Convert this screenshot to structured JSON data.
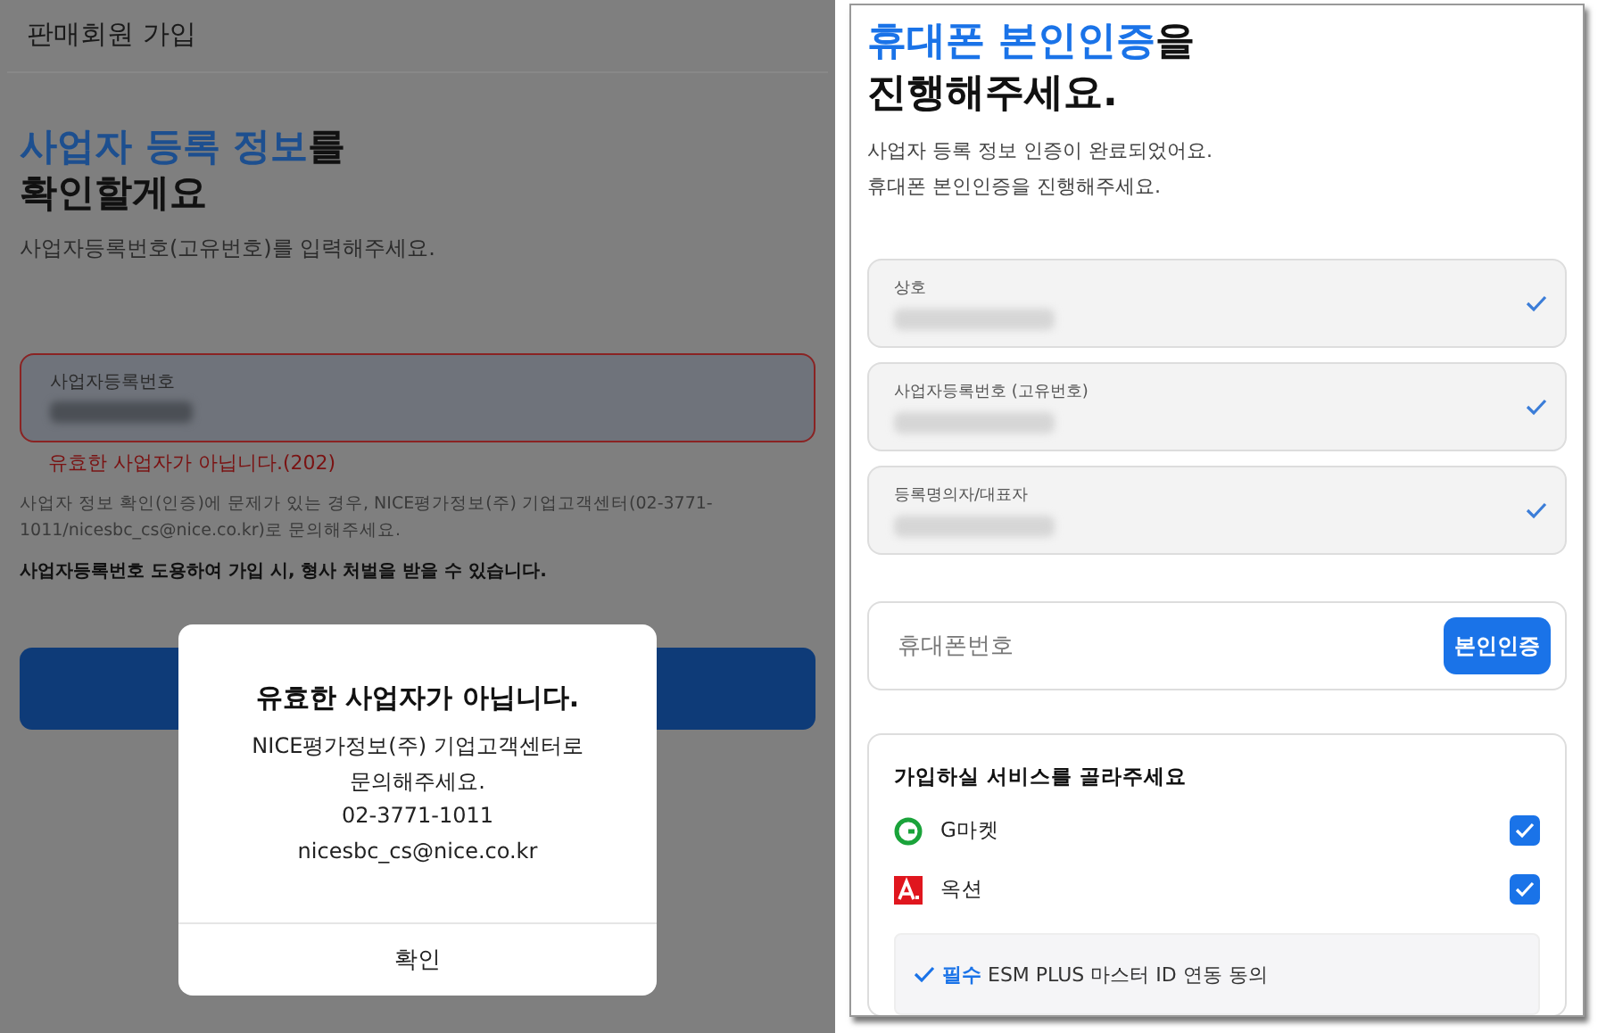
{
  "left_screen": {
    "header_title": "판매회원 가입",
    "heading_highlight": "사업자 등록 정보",
    "heading_rest": "를",
    "heading_line2": "확인할게요",
    "subtitle": "사업자등록번호(고유번호)를 입력해주세요.",
    "field": {
      "label": "사업자등록번호",
      "error": true
    },
    "error_message": "유효한 사업자가 아닙니다.(202)",
    "help_text": "사업자 정보 확인(인증)에 문제가 있는 경우, NICE평가정보(주) 기업고객센터(02-3771-1011/nicesbc_cs@nice.co.kr)로 문의해주세요.",
    "warning": "사업자등록번호 도용하여 가입 시, 형사 처벌을 받을 수 있습니다.",
    "dialog": {
      "title": "유효한 사업자가 아닙니다.",
      "lines": [
        "NICE평가정보(주) 기업고객센터로",
        "문의해주세요.",
        "02-3771-1011",
        "nicesbc_cs@nice.co.kr"
      ],
      "button": "확인"
    }
  },
  "right_screen": {
    "heading_highlight": "휴대폰 본인인증",
    "heading_rest": "을",
    "heading_line2": "진행해주세요.",
    "subtitle_lines": [
      "사업자 등록 정보 인증이 완료되었어요.",
      "휴대폰 본인인증을 진행해주세요."
    ],
    "verified_fields": [
      {
        "label": "상호",
        "verified": true
      },
      {
        "label": "사업자등록번호 (고유번호)",
        "verified": true
      },
      {
        "label": "등록명의자/대표자",
        "verified": true
      }
    ],
    "phone_field": {
      "placeholder": "휴대폰번호",
      "button": "본인인증"
    },
    "services": {
      "title": "가입하실 서비스를 골라주세요",
      "items": [
        {
          "name": "G마켓",
          "kind": "gmarket",
          "checked": true
        },
        {
          "name": "옥션",
          "kind": "auction",
          "checked": true
        }
      ],
      "consent": {
        "tag": "필수",
        "text": "ESM PLUS 마스터 ID 연동 동의",
        "checked": true
      }
    }
  }
}
